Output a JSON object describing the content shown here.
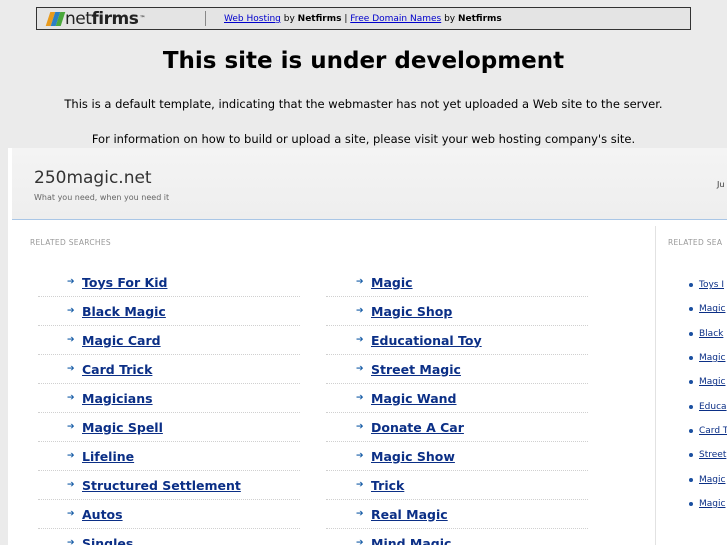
{
  "banner": {
    "logo_net": "net",
    "logo_firms": "firms",
    "logo_tm": "™",
    "link_hosting": "Web Hosting",
    "by_1": " by ",
    "brand_1": "Netfirms",
    "pipe": " | ",
    "link_domains": "Free Domain Names",
    "by_2": " by ",
    "brand_2": "Netfirms"
  },
  "headline": "This site is under development",
  "notice_1": "This is a default template, indicating that the webmaster has not yet uploaded a Web site to the server.",
  "notice_2": "For information on how to build or upload a site, please visit your web hosting company's site.",
  "parked": {
    "domain": "250magic.net",
    "tagline": "What you need, when you need it",
    "right_text": "Ju",
    "related_label": "RELATED SEARCHES",
    "related_label_side": "RELATED SEA",
    "left_column": [
      "Toys For Kid",
      "Black Magic",
      "Magic Card",
      "Card Trick",
      "Magicians",
      "Magic Spell",
      "Lifeline",
      "Structured Settlement",
      "Autos",
      "Singles"
    ],
    "right_column": [
      "Magic",
      "Magic Shop",
      "Educational Toy",
      "Street Magic",
      "Magic Wand",
      "Donate A Car",
      "Magic Show",
      "Trick",
      "Real Magic",
      "Mind Magic"
    ],
    "side_column": [
      "Toys I",
      "Magic",
      "Black",
      "Magic",
      "Magic",
      "Educa",
      "Card T",
      "Street",
      "Magic",
      "Magic"
    ]
  },
  "colors": {
    "link": "#0b2f86",
    "arrow": "#1a5fa8",
    "page_bg": "#ebebeb"
  },
  "icons": {
    "arrow": "right-arrow-icon",
    "bullet": "bullet-icon"
  }
}
